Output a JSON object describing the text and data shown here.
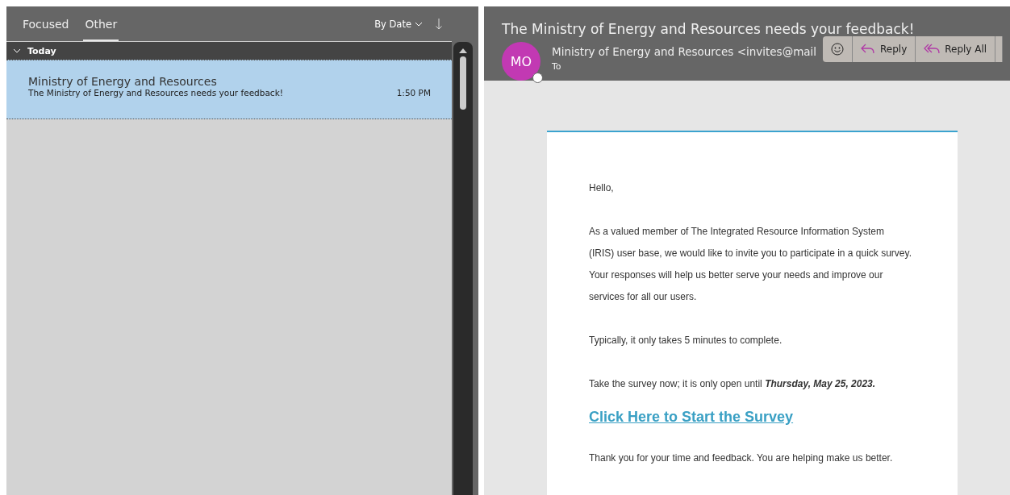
{
  "tabs": [
    {
      "label": "Focused",
      "selected": false
    },
    {
      "label": "Other",
      "selected": true
    }
  ],
  "sort": {
    "label": "By Date"
  },
  "group": {
    "label": "Today",
    "expanded": true
  },
  "messages": [
    {
      "sender": "Ministry of Energy and Resources",
      "subject": "The Ministry of Energy and Resources needs your feedback!",
      "time": "1:50 PM",
      "selected": true
    }
  ],
  "reading": {
    "subject": "The Ministry of Energy and Resources needs your feedback!",
    "avatar": "MO",
    "from": "Ministry of Energy and Resources <invites@mail",
    "to": "To",
    "actions": [
      {
        "kind": "emoji"
      },
      {
        "kind": "reply",
        "label": "Reply"
      },
      {
        "kind": "replyall",
        "label": "Reply All"
      }
    ]
  },
  "body": {
    "greeting": "Hello,",
    "paragraphs": [
      "As a valued member of The Integrated Resource Information System (IRIS) user base, we would like to invite you to participate in a quick survey. Your responses will help us better serve your needs and improve our services for all our users.",
      "Typically, it only takes 5 minutes to complete.",
      "Take the survey now; it is only open until **Thursday, May 25, 2023.**"
    ],
    "link": "Click Here to Start the Survey",
    "closing": "Thank you for your time and feedback. You are helping make us better."
  }
}
